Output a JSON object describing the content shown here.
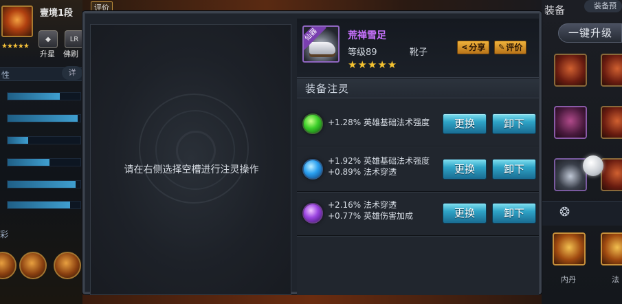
{
  "background": {
    "hero": {
      "rank": "壹境1段",
      "eval_label": "评价",
      "stars": "★★★★★",
      "badges": [
        {
          "label": "升星"
        },
        {
          "label": "佛刷"
        }
      ]
    },
    "left_section_label": "性",
    "detail_pill": "详",
    "stat_fractions": [
      0.72,
      0.96,
      0.28,
      0.58,
      0.93,
      0.86
    ],
    "left_section_label2": "彩",
    "right": {
      "equip_title": "装备",
      "equip_preview": "装备预",
      "upgrade_button": "一键升级",
      "bottom_labels": [
        "内丹",
        "法"
      ]
    }
  },
  "modal": {
    "hint": "请在右侧选择空槽进行注灵操作",
    "item": {
      "ribbon": "仙器",
      "name": "荒禅雪足",
      "level": "等级89",
      "type": "靴子",
      "stars": "★★★★★",
      "share_label": "分享",
      "eval_label": "评价"
    },
    "section_title": "装备注灵",
    "rows": [
      {
        "gem": "green-gem-icon",
        "lines": [
          "+1.28% 英雄基础法术强度"
        ],
        "replace_label": "更换",
        "remove_label": "卸下"
      },
      {
        "gem": "blue-gem-icon",
        "lines": [
          "+1.92% 英雄基础法术强度",
          "+0.89% 法术穿透"
        ],
        "replace_label": "更换",
        "remove_label": "卸下"
      },
      {
        "gem": "purple-gem-icon",
        "lines": [
          "+2.16% 法术穿透",
          "+0.77% 英雄伤害加成"
        ],
        "replace_label": "更换",
        "remove_label": "卸下"
      }
    ]
  },
  "colors": {
    "item_name": "#c872ff",
    "star": "#f5c330",
    "button_blue": "#2ea3c6",
    "button_gold": "#f0b23a"
  }
}
